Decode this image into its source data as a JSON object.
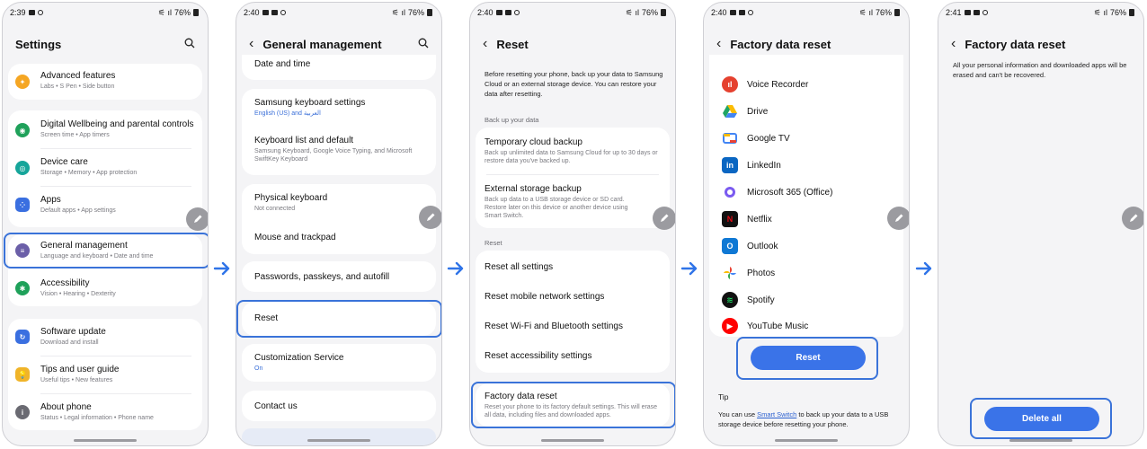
{
  "screen1": {
    "time": "2:39",
    "battery": "76%",
    "title": "Settings",
    "items": [
      {
        "title": "Advanced features",
        "sub": "Labs • S Pen • Side button"
      },
      {
        "title": "Digital Wellbeing and parental controls",
        "sub": "Screen time • App timers"
      },
      {
        "title": "Device care",
        "sub": "Storage • Memory • App protection"
      },
      {
        "title": "Apps",
        "sub": "Default apps • App settings"
      },
      {
        "title": "General management",
        "sub": "Language and keyboard • Date and time"
      },
      {
        "title": "Accessibility",
        "sub": "Vision • Hearing • Dexterity"
      },
      {
        "title": "Software update",
        "sub": "Download and install"
      },
      {
        "title": "Tips and user guide",
        "sub": "Useful tips • New features"
      },
      {
        "title": "About phone",
        "sub": "Status • Legal information • Phone name"
      }
    ]
  },
  "screen2": {
    "time": "2:40",
    "battery": "76%",
    "title": "General management",
    "items": [
      {
        "title": "Date and time",
        "sub": ""
      },
      {
        "title": "Samsung keyboard settings",
        "sub": "English (US) and العربية"
      },
      {
        "title": "Keyboard list and default",
        "sub": "Samsung Keyboard, Google Voice Typing, and Microsoft SwiftKey Keyboard"
      },
      {
        "title": "Physical keyboard",
        "sub": "Not connected"
      },
      {
        "title": "Mouse and trackpad",
        "sub": ""
      },
      {
        "title": "Passwords, passkeys, and autofill",
        "sub": ""
      },
      {
        "title": "Reset",
        "sub": ""
      },
      {
        "title": "Customization Service",
        "sub": "On"
      },
      {
        "title": "Contact us",
        "sub": ""
      }
    ]
  },
  "screen3": {
    "time": "2:40",
    "battery": "76%",
    "title": "Reset",
    "intro": "Before resetting your phone, back up your data to Samsung Cloud or an external storage device. You can restore your data after resetting.",
    "backup_label": "Back up your data",
    "backup_items": [
      {
        "title": "Temporary cloud backup",
        "sub": "Back up unlimited data to Samsung Cloud for up to 30 days or restore data you've backed up."
      },
      {
        "title": "External storage backup",
        "sub": "Back up data to a USB storage device or SD card. Restore later on this device or another device using Smart Switch."
      }
    ],
    "reset_label": "Reset",
    "reset_items": [
      {
        "title": "Reset all settings"
      },
      {
        "title": "Reset mobile network settings"
      },
      {
        "title": "Reset Wi-Fi and Bluetooth settings"
      },
      {
        "title": "Reset accessibility settings"
      }
    ],
    "factory": {
      "title": "Factory data reset",
      "sub": "Reset your phone to its factory default settings. This will erase all data, including files and downloaded apps."
    }
  },
  "screen4": {
    "time": "2:40",
    "battery": "76%",
    "title": "Factory data reset",
    "apps": [
      "Voice Recorder",
      "Drive",
      "Google TV",
      "LinkedIn",
      "Microsoft 365 (Office)",
      "Netflix",
      "Outlook",
      "Photos",
      "Spotify",
      "YouTube Music"
    ],
    "reset_button": "Reset",
    "tip_label": "Tip",
    "tip_prefix": "You can use ",
    "tip_link": "Smart Switch",
    "tip_suffix": " to back up your data to a USB storage device before resetting your phone."
  },
  "screen5": {
    "time": "2:41",
    "battery": "76%",
    "title": "Factory data reset",
    "message": "All your personal information and downloaded apps will be erased and can't be recovered.",
    "delete_button": "Delete all"
  },
  "colors": {
    "accent": "#3a73d9",
    "button": "#3a73e8",
    "background": "#f4f4f6"
  }
}
